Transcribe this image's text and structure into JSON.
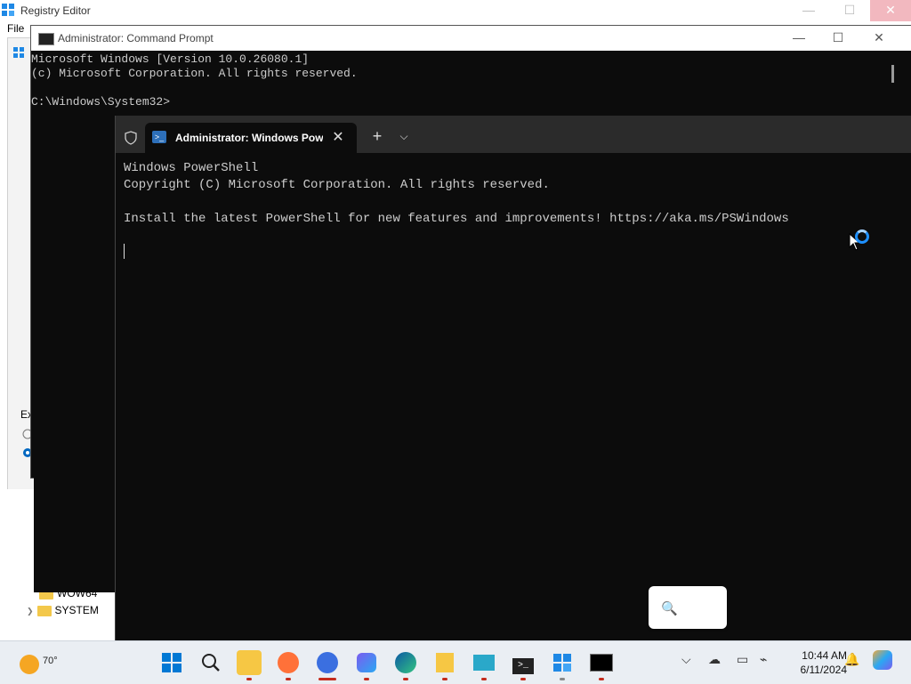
{
  "regedit": {
    "title": "Registry Editor",
    "menu_file": "File",
    "dialog_fragment": "Ex",
    "tree_items": [
      "WOW64",
      "SYSTEM"
    ]
  },
  "cmd": {
    "title": "Administrator: Command Prompt",
    "lines": [
      "Microsoft Windows [Version 10.0.26080.1]",
      "(c) Microsoft Corporation. All rights reserved.",
      "",
      "C:\\Windows\\System32>"
    ]
  },
  "terminal": {
    "tab_title": "Administrator: Windows PowerShell",
    "lines": [
      "Windows PowerShell",
      "Copyright (C) Microsoft Corporation. All rights reserved.",
      "",
      "Install the latest PowerShell for new features and improvements! https://aka.ms/PSWindows"
    ]
  },
  "taskbar": {
    "weather_temp": "70°",
    "clock_time": "10:44 AM",
    "clock_date": "6/11/2024",
    "pinned": [
      {
        "name": "start-icon"
      },
      {
        "name": "search-icon"
      },
      {
        "name": "file-explorer-icon"
      },
      {
        "name": "firefox-icon"
      },
      {
        "name": "firefox-dev-icon"
      },
      {
        "name": "copilot-app-icon"
      },
      {
        "name": "edge-icon"
      },
      {
        "name": "onedrive-folder-icon"
      },
      {
        "name": "remote-desktop-icon"
      },
      {
        "name": "terminal-icon"
      },
      {
        "name": "regedit-icon"
      },
      {
        "name": "cmd-icon"
      }
    ]
  },
  "colors": {
    "console_bg": "#0c0c0c",
    "console_fg": "#cccccc",
    "terminal_tab_bg": "#2b2b2b",
    "taskbar_bg": "#eaeef3",
    "accent": "#0078d4",
    "running_indicator": "#c42b1c"
  }
}
